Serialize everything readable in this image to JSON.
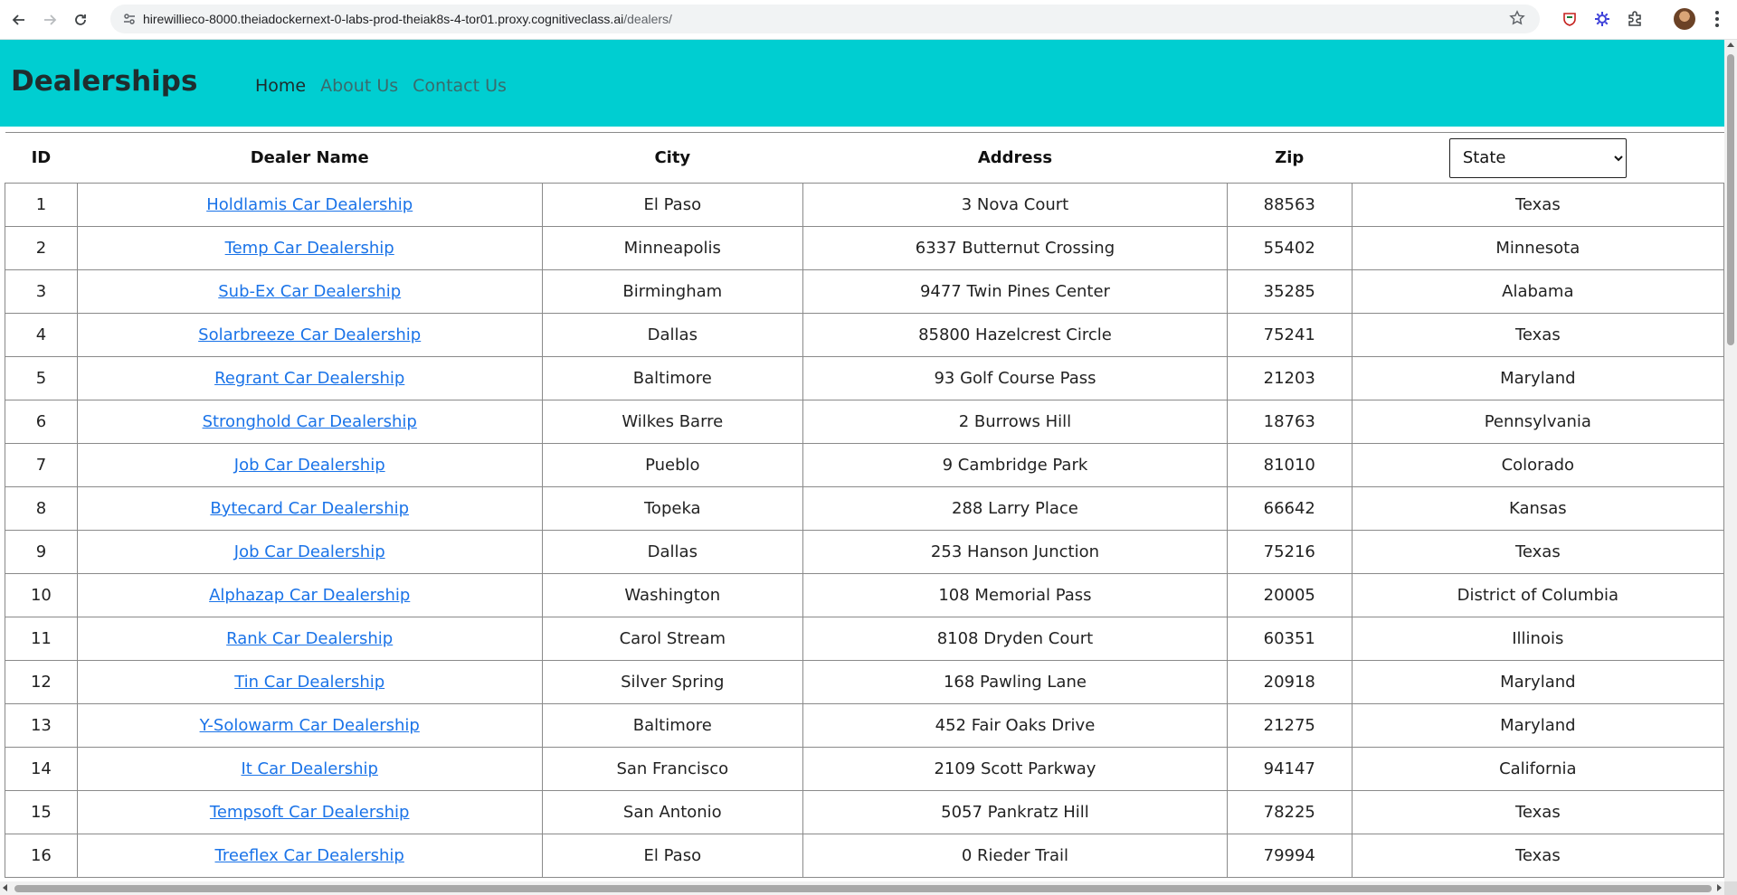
{
  "browser": {
    "url_host": "hirewillieco-8000.theiadockernext-0-labs-prod-theiak8s-4-tor01.proxy.cognitiveclass.ai",
    "url_path": "/dealers/"
  },
  "navbar": {
    "brand": "Dealerships",
    "links": [
      "Home",
      "About Us",
      "Contact Us"
    ],
    "background": "#00ced1"
  },
  "table": {
    "headers": {
      "id": "ID",
      "name": "Dealer Name",
      "city": "City",
      "address": "Address",
      "zip": "Zip"
    },
    "state_filter": {
      "selected": "State"
    },
    "rows": [
      {
        "id": "1",
        "name": "Holdlamis Car Dealership",
        "city": "El Paso",
        "address": "3 Nova Court",
        "zip": "88563",
        "state": "Texas"
      },
      {
        "id": "2",
        "name": "Temp Car Dealership",
        "city": "Minneapolis",
        "address": "6337 Butternut Crossing",
        "zip": "55402",
        "state": "Minnesota"
      },
      {
        "id": "3",
        "name": "Sub-Ex Car Dealership",
        "city": "Birmingham",
        "address": "9477 Twin Pines Center",
        "zip": "35285",
        "state": "Alabama"
      },
      {
        "id": "4",
        "name": "Solarbreeze Car Dealership",
        "city": "Dallas",
        "address": "85800 Hazelcrest Circle",
        "zip": "75241",
        "state": "Texas"
      },
      {
        "id": "5",
        "name": "Regrant Car Dealership",
        "city": "Baltimore",
        "address": "93 Golf Course Pass",
        "zip": "21203",
        "state": "Maryland"
      },
      {
        "id": "6",
        "name": "Stronghold Car Dealership",
        "city": "Wilkes Barre",
        "address": "2 Burrows Hill",
        "zip": "18763",
        "state": "Pennsylvania"
      },
      {
        "id": "7",
        "name": "Job Car Dealership",
        "city": "Pueblo",
        "address": "9 Cambridge Park",
        "zip": "81010",
        "state": "Colorado"
      },
      {
        "id": "8",
        "name": "Bytecard Car Dealership",
        "city": "Topeka",
        "address": "288 Larry Place",
        "zip": "66642",
        "state": "Kansas"
      },
      {
        "id": "9",
        "name": "Job Car Dealership",
        "city": "Dallas",
        "address": "253 Hanson Junction",
        "zip": "75216",
        "state": "Texas"
      },
      {
        "id": "10",
        "name": "Alphazap Car Dealership",
        "city": "Washington",
        "address": "108 Memorial Pass",
        "zip": "20005",
        "state": "District of Columbia"
      },
      {
        "id": "11",
        "name": "Rank Car Dealership",
        "city": "Carol Stream",
        "address": "8108 Dryden Court",
        "zip": "60351",
        "state": "Illinois"
      },
      {
        "id": "12",
        "name": "Tin Car Dealership",
        "city": "Silver Spring",
        "address": "168 Pawling Lane",
        "zip": "20918",
        "state": "Maryland"
      },
      {
        "id": "13",
        "name": "Y-Solowarm Car Dealership",
        "city": "Baltimore",
        "address": "452 Fair Oaks Drive",
        "zip": "21275",
        "state": "Maryland"
      },
      {
        "id": "14",
        "name": "It Car Dealership",
        "city": "San Francisco",
        "address": "2109 Scott Parkway",
        "zip": "94147",
        "state": "California"
      },
      {
        "id": "15",
        "name": "Tempsoft Car Dealership",
        "city": "San Antonio",
        "address": "5057 Pankratz Hill",
        "zip": "78225",
        "state": "Texas"
      },
      {
        "id": "16",
        "name": "Treeflex Car Dealership",
        "city": "El Paso",
        "address": "0 Rieder Trail",
        "zip": "79994",
        "state": "Texas"
      }
    ]
  }
}
